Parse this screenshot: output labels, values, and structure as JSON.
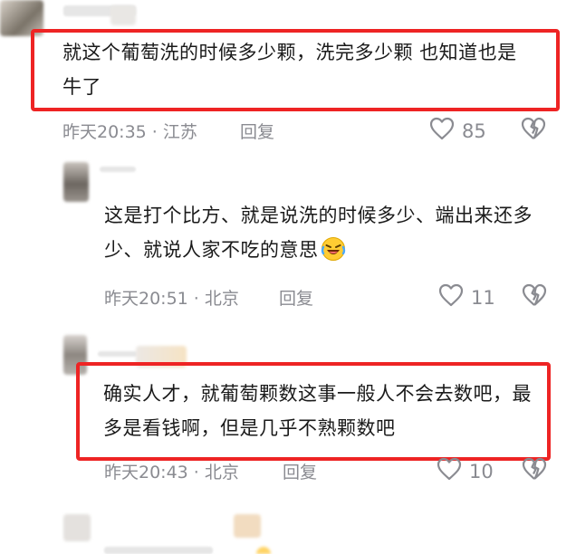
{
  "comments": [
    {
      "text": "就这个葡萄洗的时候多少颗，洗完多少颗 也知道也是牛了",
      "time": "昨天20:35",
      "location": "江苏",
      "reply_label": "回复",
      "likes": "85"
    },
    {
      "text": "这是打个比方、就是说洗的时候多少、端出来还多少、就说人家不吃的意思",
      "time": "昨天20:51",
      "location": "北京",
      "reply_label": "回复",
      "likes": "11"
    },
    {
      "text": "确实人才，就葡萄颗数这事一般人不会去数吧，最多是看钱啊，但是几乎不熟颗数吧",
      "time": "昨天20:43",
      "location": "北京",
      "reply_label": "回复",
      "likes": "10"
    }
  ],
  "icons": {
    "like": "heart-outline",
    "dislike": "broken-heart-outline",
    "emoji": "laughing-tears-emoji"
  },
  "colors": {
    "highlight_border": "#ee2424",
    "meta_text": "#8a8b91",
    "body_text": "#1a1a1a"
  }
}
